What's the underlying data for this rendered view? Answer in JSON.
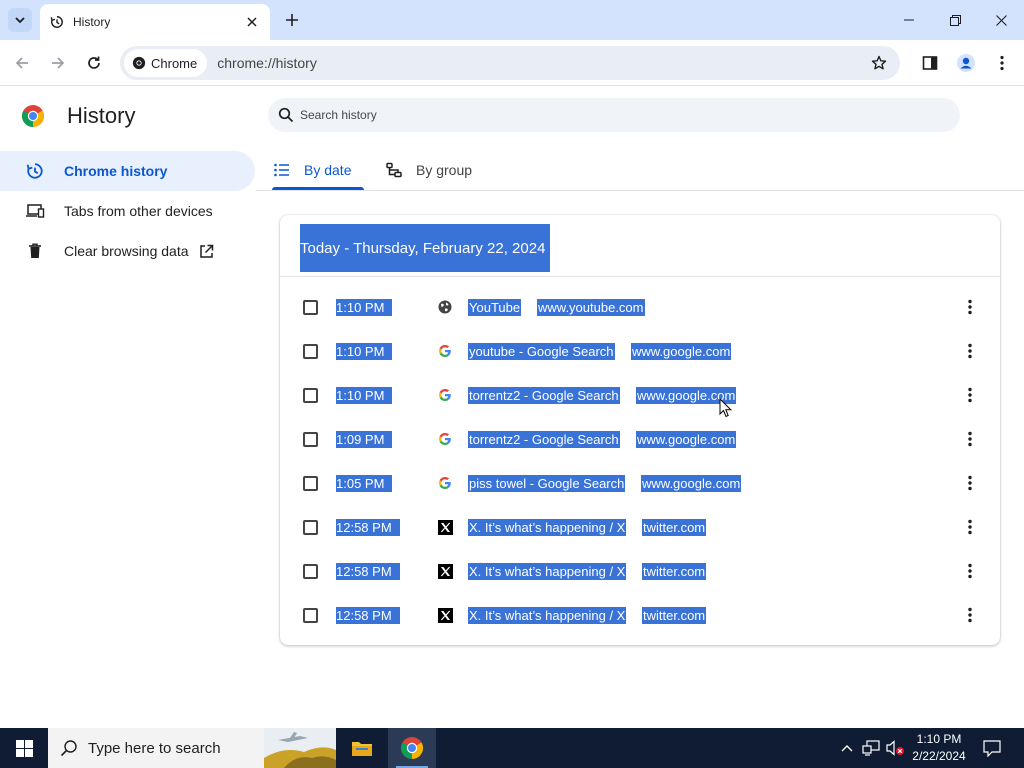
{
  "browser": {
    "tab_title": "History",
    "chip_label": "Chrome",
    "url": "chrome://history"
  },
  "sidebar": {
    "title": "History",
    "items": [
      {
        "label": "Chrome history",
        "icon": "history-icon",
        "active": true
      },
      {
        "label": "Tabs from other devices",
        "icon": "devices-icon",
        "active": false
      },
      {
        "label": "Clear browsing data",
        "icon": "trash-icon",
        "active": false
      }
    ]
  },
  "search": {
    "placeholder": "Search history"
  },
  "view_tabs": [
    {
      "label": "By date",
      "icon": "list-icon",
      "active": true
    },
    {
      "label": "By group",
      "icon": "group-icon",
      "active": false
    }
  ],
  "history": {
    "heading": "Today - Thursday, February 22, 2024",
    "entries": [
      {
        "time": "1:10 PM",
        "title": "YouTube",
        "domain": "www.youtube.com",
        "favicon": "globe-icon"
      },
      {
        "time": "1:10 PM",
        "title": "youtube - Google Search",
        "domain": "www.google.com",
        "favicon": "google-icon"
      },
      {
        "time": "1:10 PM",
        "title": "torrentz2 - Google Search",
        "domain": "www.google.com",
        "favicon": "google-icon"
      },
      {
        "time": "1:09 PM",
        "title": "torrentz2 - Google Search",
        "domain": "www.google.com",
        "favicon": "google-icon"
      },
      {
        "time": "1:05 PM",
        "title": "piss towel - Google Search",
        "domain": "www.google.com",
        "favicon": "google-icon"
      },
      {
        "time": "12:58 PM",
        "title": "X. It’s what’s happening / X",
        "domain": "twitter.com",
        "favicon": "x-icon"
      },
      {
        "time": "12:58 PM",
        "title": "X. It’s what’s happening / X",
        "domain": "twitter.com",
        "favicon": "x-icon"
      },
      {
        "time": "12:58 PM",
        "title": "X. It’s what’s happening / X",
        "domain": "twitter.com",
        "favicon": "x-icon"
      }
    ]
  },
  "taskbar": {
    "search_placeholder": "Type here to search",
    "time": "1:10 PM",
    "date": "2/22/2024"
  },
  "colors": {
    "selection": "#3a73d8",
    "accent": "#0b57d0",
    "tabstrip": "#d3e3fd",
    "taskbar": "#101c33"
  }
}
